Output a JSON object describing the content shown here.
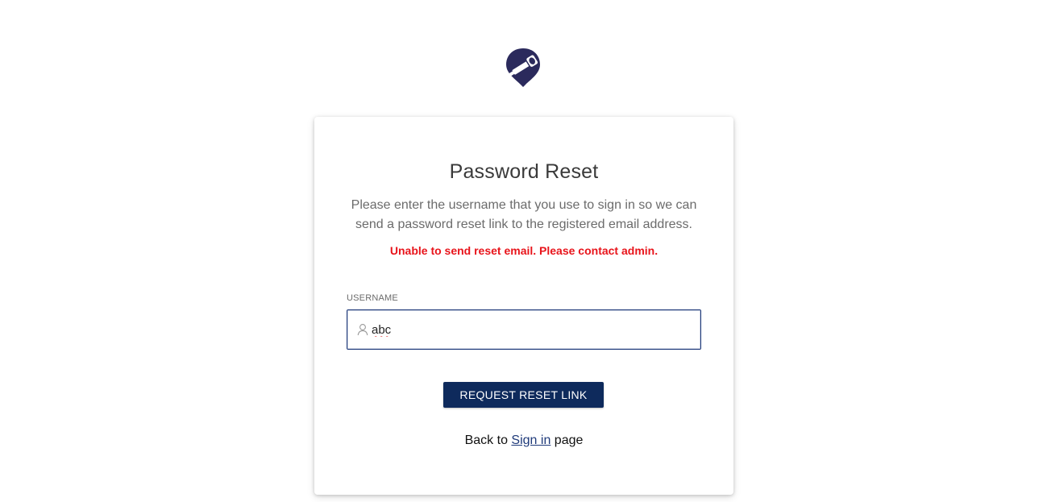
{
  "brand": {
    "logo_icon": "telescope-pin-icon",
    "logo_color": "#2b2a5c"
  },
  "card": {
    "title": "Password Reset",
    "description": "Please enter the username that you use to sign in so we can send a password reset link to the registered email address.",
    "error_message": "Unable to send reset email. Please contact admin.",
    "error_color": "#e8141b"
  },
  "form": {
    "username_label": "USERNAME",
    "username_value": "abc",
    "username_icon": "user-icon",
    "submit_label": "REQUEST RESET LINK",
    "submit_color": "#0e2a5c"
  },
  "footer": {
    "back_prefix": "Back to",
    "sign_in_link": "Sign in",
    "back_suffix": "page"
  }
}
